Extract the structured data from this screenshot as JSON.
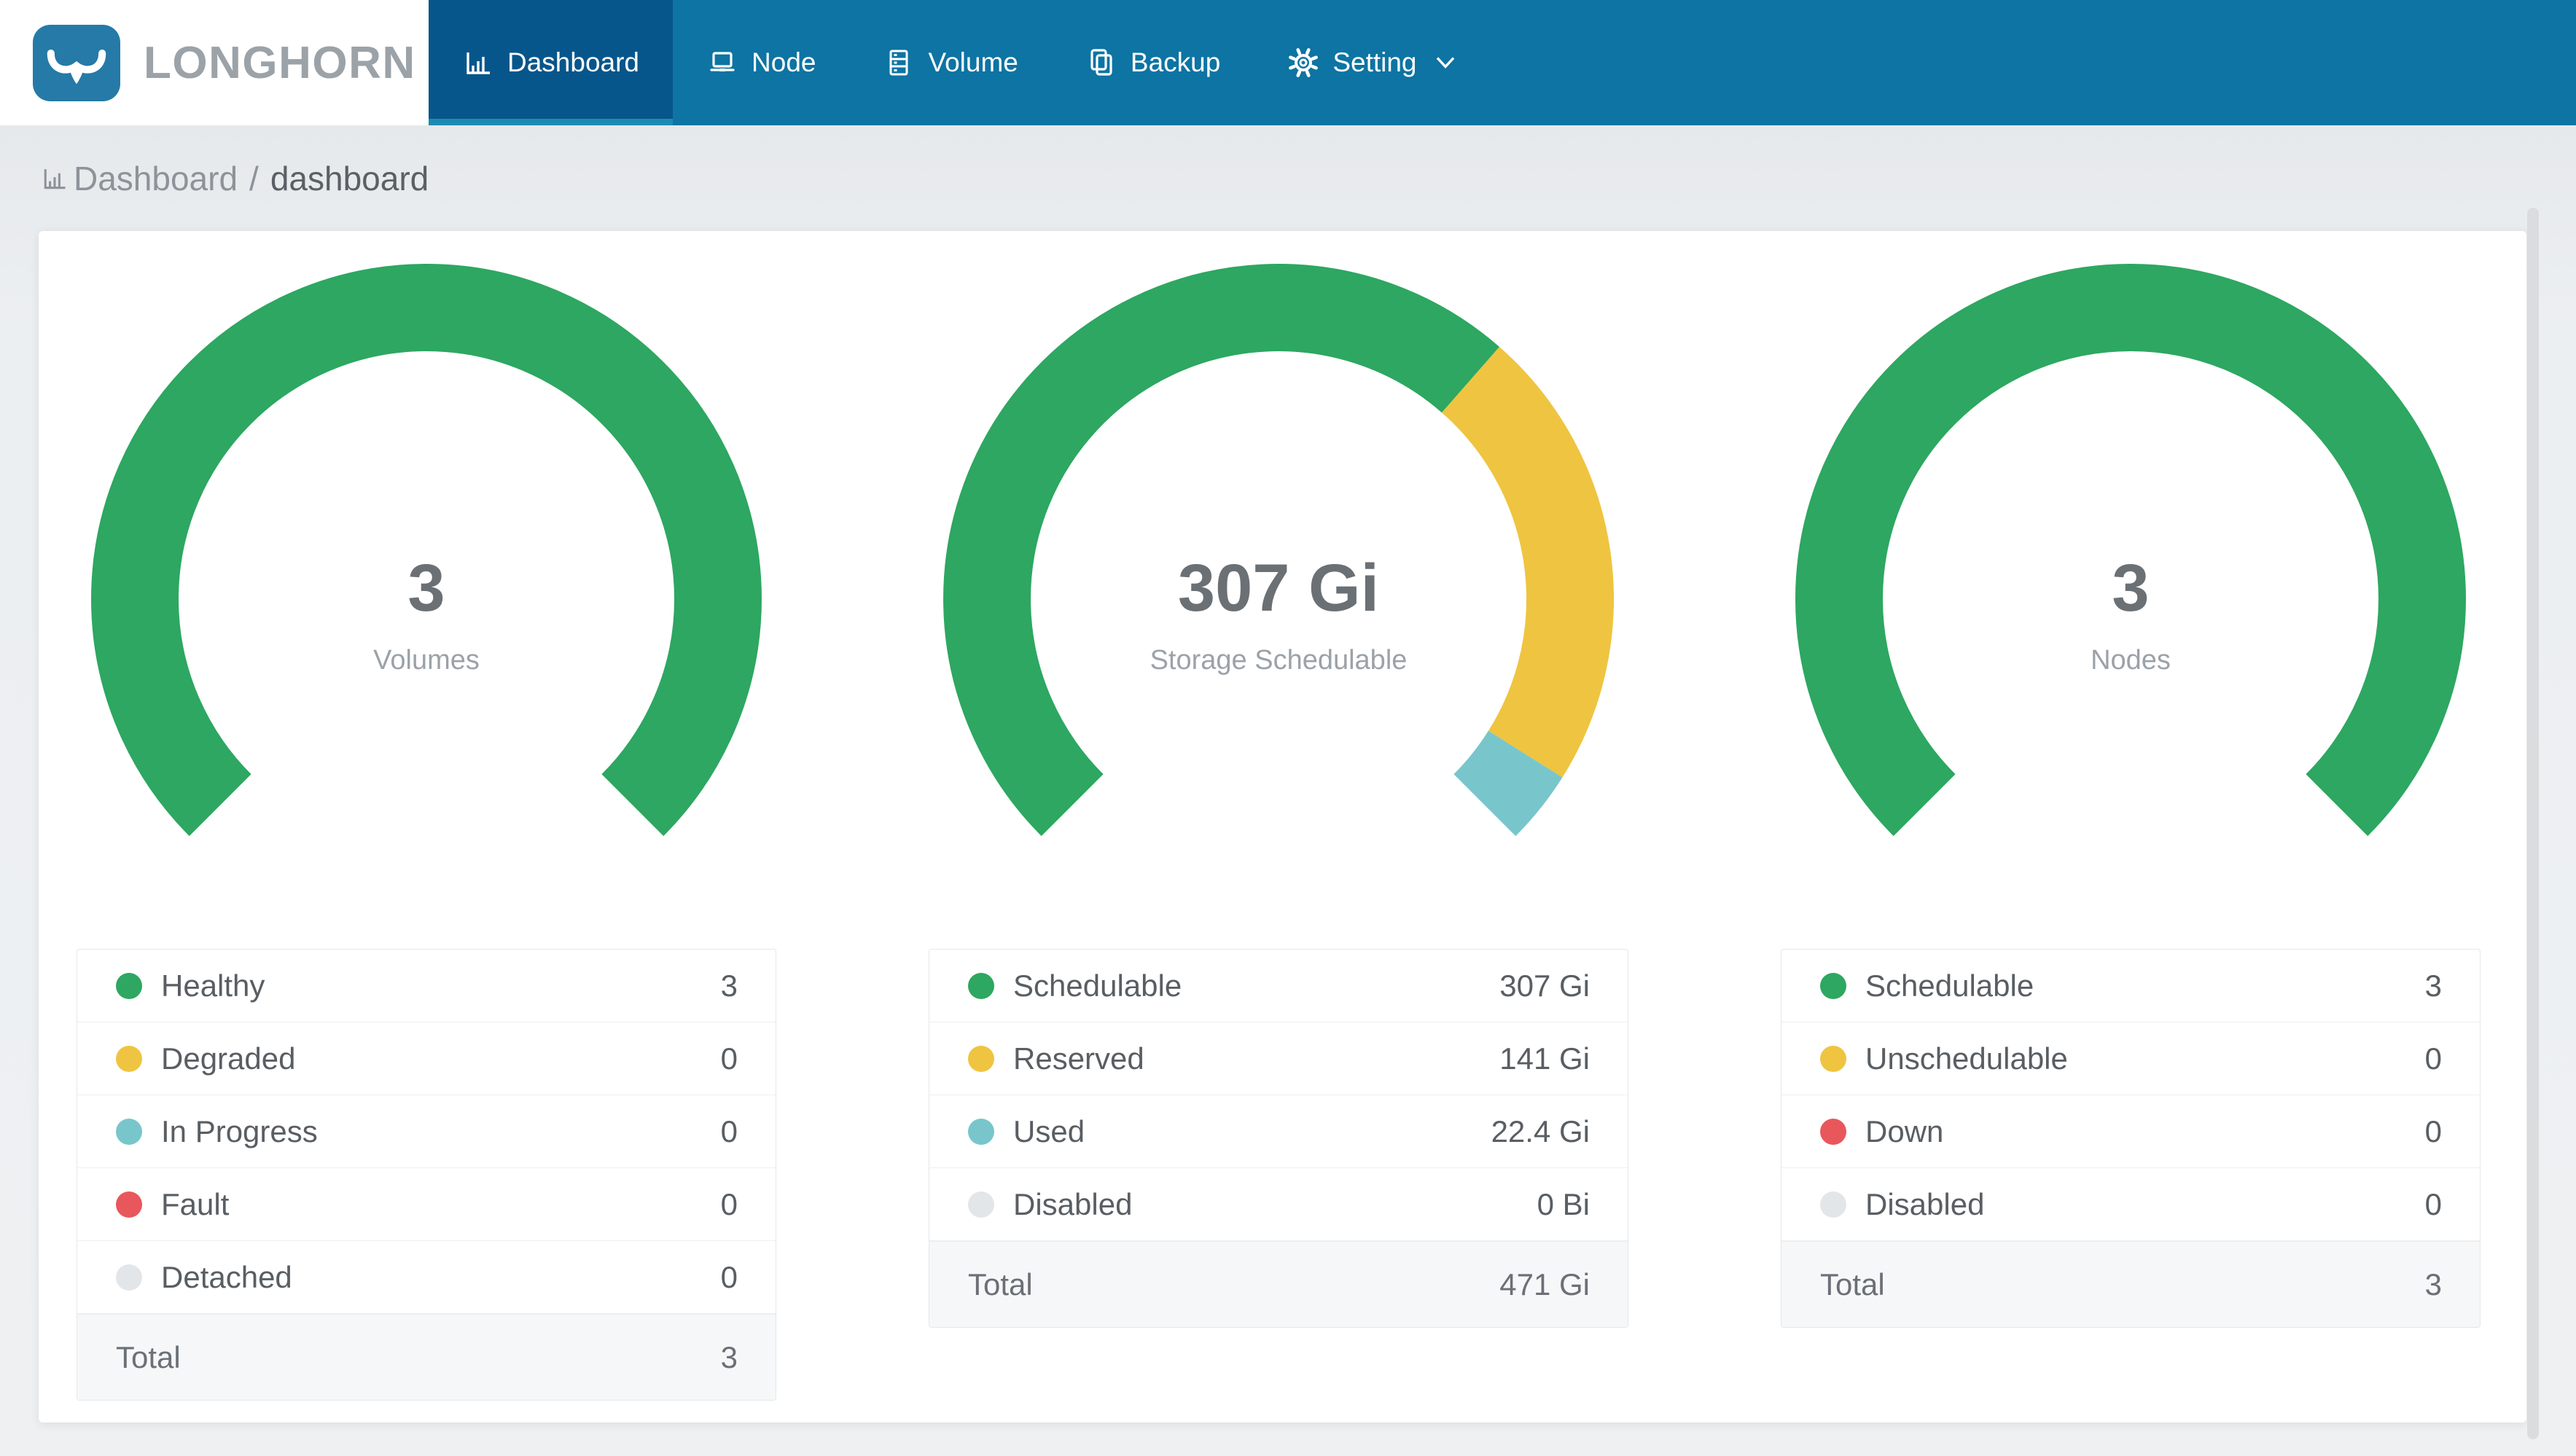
{
  "brand": {
    "name": "LONGHORN",
    "logo_icon": "bull-icon"
  },
  "navbar": {
    "items": [
      {
        "label": "Dashboard",
        "icon": "bar-chart-icon",
        "active": true,
        "has_dropdown": false
      },
      {
        "label": "Node",
        "icon": "laptop-icon",
        "active": false,
        "has_dropdown": false
      },
      {
        "label": "Volume",
        "icon": "server-icon",
        "active": false,
        "has_dropdown": false
      },
      {
        "label": "Backup",
        "icon": "copy-icon",
        "active": false,
        "has_dropdown": false
      },
      {
        "label": "Setting",
        "icon": "gear-icon",
        "active": false,
        "has_dropdown": true
      }
    ]
  },
  "breadcrumb": {
    "icon": "bar-chart-icon",
    "section": "Dashboard",
    "separator": "/",
    "page": "dashboard"
  },
  "colors": {
    "navbar_bg": "#0d74a3",
    "active_tab_bg": "#07568b",
    "active_tab_underline": "#1d8ab4",
    "logo_bg": "#257aa7",
    "brand_text": "#9ba2a8",
    "page_bg": "#eef0f2",
    "card_bg": "#ffffff",
    "green": "#2da761",
    "yellow": "#efc440",
    "teal": "#78c6cb",
    "red": "#e8575c",
    "gray": "#e3e6e9"
  },
  "chart_data": [
    {
      "type": "gauge-donut",
      "name": "volumes",
      "center_value": "3",
      "center_label": "Volumes",
      "start_angle": 225,
      "sweep_angle": 270,
      "segments": [
        {
          "label": "Healthy",
          "value": 3,
          "display": "3",
          "color": "green"
        },
        {
          "label": "Degraded",
          "value": 0,
          "display": "0",
          "color": "yellow"
        },
        {
          "label": "In Progress",
          "value": 0,
          "display": "0",
          "color": "teal"
        },
        {
          "label": "Fault",
          "value": 0,
          "display": "0",
          "color": "red"
        },
        {
          "label": "Detached",
          "value": 0,
          "display": "0",
          "color": "gray"
        }
      ],
      "total": {
        "label": "Total",
        "display": "3"
      }
    },
    {
      "type": "gauge-donut",
      "name": "storage",
      "center_value": "307 Gi",
      "center_label": "Storage Schedulable",
      "start_angle": 225,
      "sweep_angle": 270,
      "segments": [
        {
          "label": "Schedulable",
          "value": 307,
          "display": "307 Gi",
          "color": "green"
        },
        {
          "label": "Reserved",
          "value": 141,
          "display": "141 Gi",
          "color": "yellow"
        },
        {
          "label": "Used",
          "value": 22.4,
          "display": "22.4 Gi",
          "color": "teal"
        },
        {
          "label": "Disabled",
          "value": 0,
          "display": "0 Bi",
          "color": "gray"
        }
      ],
      "total": {
        "label": "Total",
        "display": "471 Gi"
      }
    },
    {
      "type": "gauge-donut",
      "name": "nodes",
      "center_value": "3",
      "center_label": "Nodes",
      "start_angle": 225,
      "sweep_angle": 270,
      "segments": [
        {
          "label": "Schedulable",
          "value": 3,
          "display": "3",
          "color": "green"
        },
        {
          "label": "Unschedulable",
          "value": 0,
          "display": "0",
          "color": "yellow"
        },
        {
          "label": "Down",
          "value": 0,
          "display": "0",
          "color": "red"
        },
        {
          "label": "Disabled",
          "value": 0,
          "display": "0",
          "color": "gray"
        }
      ],
      "total": {
        "label": "Total",
        "display": "3"
      }
    }
  ]
}
